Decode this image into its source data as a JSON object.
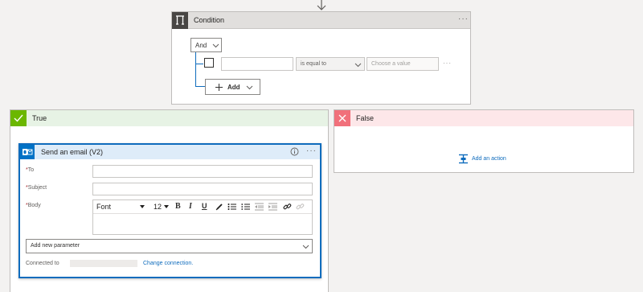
{
  "condition": {
    "title": "Condition",
    "and_label": "And",
    "operator": "is equal to",
    "value_placeholder": "Choose a value",
    "add_label": "Add"
  },
  "true_branch": {
    "title": "True",
    "action": {
      "title": "Send an email (V2)",
      "fields": {
        "to": "To",
        "subject": "Subject",
        "body": "Body"
      },
      "toolbar": {
        "font": "Font",
        "size": "12",
        "bold": "B",
        "italic": "I",
        "underline": "U"
      },
      "add_param": "Add new parameter",
      "connected_to": "Connected to",
      "change_connection": "Change connection."
    }
  },
  "false_branch": {
    "title": "False",
    "add_action": "Add an action"
  },
  "colors": {
    "accent": "#0f6cbd",
    "true_header": "#e7f3e5",
    "true_icon": "#6bb700",
    "false_header": "#fde7e9",
    "false_icon": "#f1707b",
    "condition_icon_bg": "#484644",
    "outlook_blue": "#0072c6"
  }
}
